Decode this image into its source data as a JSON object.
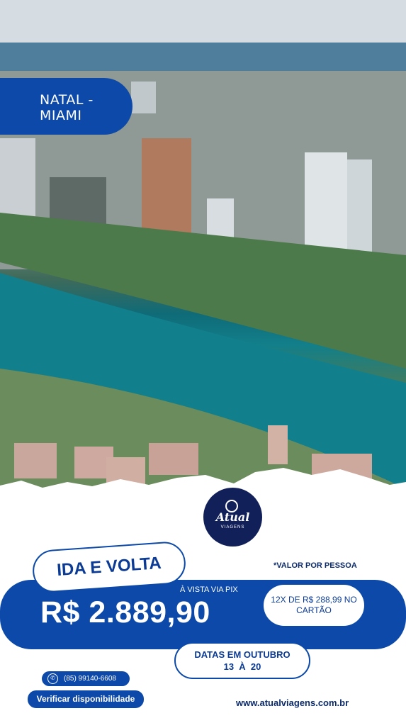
{
  "route": {
    "line1": "NATAL -",
    "line2": "MIAMI"
  },
  "logo": {
    "name": "Atual",
    "sub": "VIAGENS"
  },
  "offer": {
    "trip_type": "IDA E VOLTA",
    "per_person": "*VALOR POR PESSOA",
    "pix_label": "À VISTA VIA PIX",
    "price": "R$ 2.889,90",
    "installments": "12X DE R$ 288,99 NO CARTÃO",
    "dates_line1": "DATAS EM OUTUBRO",
    "dates_line2": "13  À  20"
  },
  "contact": {
    "phone": "(85) 99140-6608",
    "verify_button": "Verificar disponibilidade",
    "website": "www.atualviagens.com.br"
  },
  "icons": {
    "phone": "whatsapp-icon",
    "logo": "globe-icon"
  },
  "colors": {
    "brand_blue": "#0c49a8",
    "navy": "#12205a",
    "water": "#127f8a"
  }
}
